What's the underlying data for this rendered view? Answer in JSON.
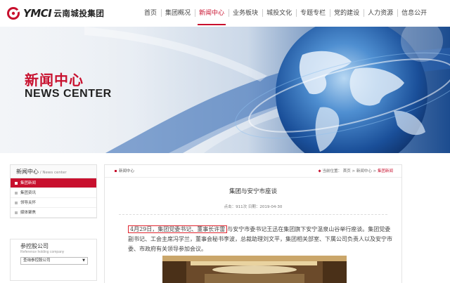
{
  "header": {
    "logo_en": "YMCI",
    "logo_cn": "云南城投集团",
    "nav": [
      "首页",
      "集团概况",
      "新闻中心",
      "业务板块",
      "城投文化",
      "专题专栏",
      "党的建设",
      "人力资源",
      "信息公开"
    ],
    "active_nav": 2
  },
  "banner": {
    "title_cn": "新闻中心",
    "title_en": "NEWS CENTER"
  },
  "sidebar": {
    "title": "新闻中心",
    "title_en": " / News center",
    "items": [
      "集团新闻",
      "集团资讯",
      "领导关怀",
      "媒体聚焦"
    ],
    "active_item": 0
  },
  "holding": {
    "title": "参控股公司",
    "subtitle": "Reference holding company",
    "select_value": "查询参控股公司"
  },
  "breadcrumb": {
    "section": "新闻中心",
    "location_label": "当前位置：",
    "path": [
      "首页",
      "新闻中心",
      "集团新闻"
    ],
    "separator": ">"
  },
  "article": {
    "title": "集团与安宁市座谈",
    "meta": "点击：911次  日期：2019-04-30",
    "highlight": "4月29日，集团党委书记、董事长许雷",
    "body_rest": "与安宁市委书记王迅在集团旗下安宁温泉山谷举行座谈。集团党委副书记、工会主席冯学兰，董事会秘书李波，总裁助理刘文平，集团相关部室、下属公司负责人以及安宁市委、市政府有关领导参加会议。"
  },
  "colors": {
    "brand_red": "#c8102e",
    "highlight_box": "#e0242e",
    "banner_blue": "#1a4b8c"
  }
}
